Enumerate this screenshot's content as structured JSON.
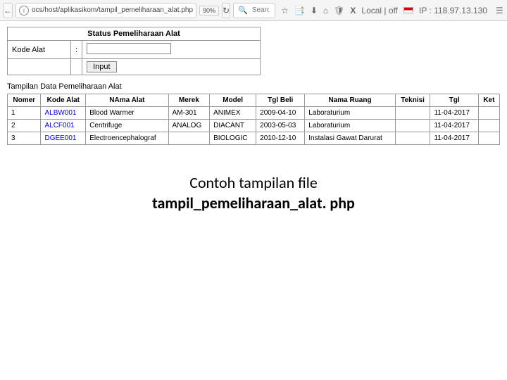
{
  "chrome": {
    "url": "ocs/host/aplikasikom/tampil_pemeliharaan_alat.php",
    "zoom": "90%",
    "search_placeholder": "Search",
    "status_label": "Local | off",
    "ip_label": "IP : 118.97.13.130"
  },
  "form": {
    "title": "Status Pemeliharaan Alat",
    "kode_alat_label": "Kode Alat",
    "separator": ":",
    "submit_label": "Input"
  },
  "subtitle": "Tampilan Data Pemeliharaan Alat",
  "table": {
    "headers": [
      "Nomer",
      "Kode Alat",
      "NAma Alat",
      "Merek",
      "Model",
      "Tgl Beli",
      "Nama Ruang",
      "Teknisi",
      "Tgl",
      "Ket"
    ],
    "rows": [
      {
        "no": "1",
        "kode": "ALBW001",
        "nama": "Blood Warmer",
        "merek": "AM-301",
        "model": "ANIMEX",
        "tgl_beli": "2009-04-10",
        "ruang": "Laboraturium",
        "teknisi": "",
        "tgl": "11-04-2017",
        "ket": ""
      },
      {
        "no": "2",
        "kode": "ALCF001",
        "nama": "Centrifuge",
        "merek": "ANALOG",
        "model": "DIACANT",
        "tgl_beli": "2003-05-03",
        "ruang": "Laboraturium",
        "teknisi": "",
        "tgl": "11-04-2017",
        "ket": ""
      },
      {
        "no": "3",
        "kode": "DGEE001",
        "nama": "Electroencephalograf",
        "merek": "",
        "model": "BIOLOGIC",
        "tgl_beli": "2010-12-10",
        "ruang": "Instalasi Gawat Darurat",
        "teknisi": "",
        "tgl": "11-04-2017",
        "ket": ""
      }
    ]
  },
  "caption": {
    "line1": "Contoh tampilan file",
    "line2": "tampil_pemeliharaan_alat. php"
  }
}
